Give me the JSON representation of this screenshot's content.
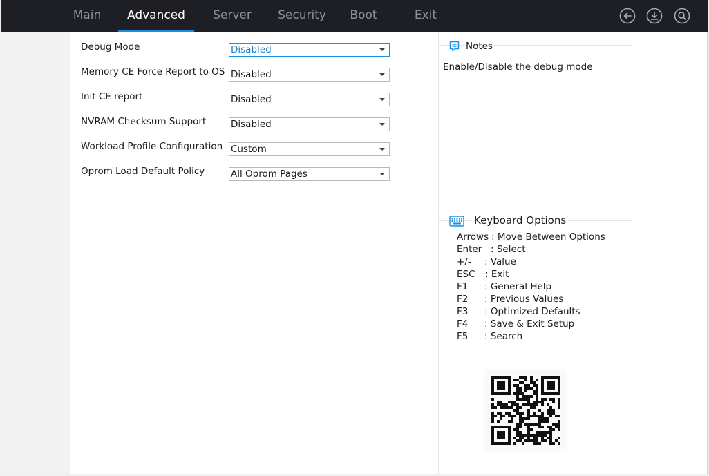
{
  "menu": {
    "tabs": [
      {
        "label": "Main"
      },
      {
        "label": "Advanced"
      },
      {
        "label": "Server"
      },
      {
        "label": "Security"
      },
      {
        "label": "Boot"
      },
      {
        "label": "Exit"
      }
    ],
    "active_tab": "Advanced",
    "nav_icons": [
      "back-icon",
      "download-icon",
      "search-icon"
    ]
  },
  "settings": [
    {
      "label": "Debug Mode",
      "value": "Disabled"
    },
    {
      "label": "Memory CE Force Report to OS",
      "value": "Disabled"
    },
    {
      "label": "Init CE report",
      "value": "Disabled"
    },
    {
      "label": "NVRAM Checksum Support",
      "value": "Disabled"
    },
    {
      "label": "Workload Profile Configuration",
      "value": "Custom"
    },
    {
      "label": "Oprom Load Default Policy",
      "value": "All Oprom Pages"
    }
  ],
  "notes": {
    "title": "Notes",
    "text": "Enable/Disable the debug mode"
  },
  "keyboard": {
    "title": "Keyboard Options",
    "options": [
      {
        "key": "Arrows",
        "desc": ": Move Between Options"
      },
      {
        "key": "Enter",
        "desc": ": Select"
      },
      {
        "key": "+/-",
        "desc": ": Value"
      },
      {
        "key": "ESC",
        "desc": ": Exit"
      },
      {
        "key": "F1",
        "desc": ": General Help"
      },
      {
        "key": "F2",
        "desc": ": Previous Values"
      },
      {
        "key": "F3",
        "desc": ": Optimized Defaults"
      },
      {
        "key": "F4",
        "desc": ": Save & Exit Setup"
      },
      {
        "key": "F5",
        "desc": ": Search"
      }
    ]
  },
  "colors": {
    "topbar": "#1d1f24",
    "accent": "#1a8fe0",
    "inactive_tab": "#8d9097"
  }
}
